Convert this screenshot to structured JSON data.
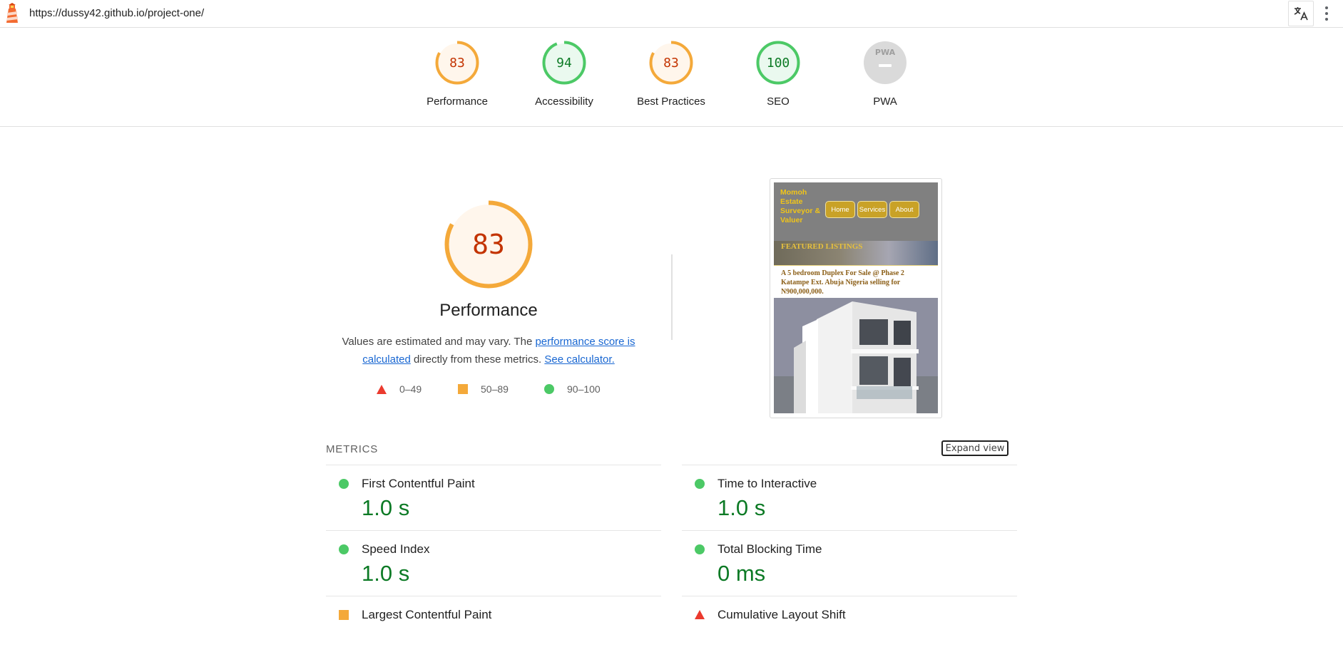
{
  "browser": {
    "url": "https://dussy42.github.io/project-one/",
    "logo_icon": "lighthouse-icon",
    "translate_icon": "translate-icon",
    "menu_icon": "more-vert-icon"
  },
  "colors": {
    "pass": "#0cce6b",
    "average": "#ffa400",
    "fail": "#ff4e42",
    "pass_text": "#0c7a25",
    "average_text": "#c33300",
    "link": "#1967d2"
  },
  "gauges": [
    {
      "label": "Performance",
      "score": "83",
      "level": "average",
      "fraction": 0.83
    },
    {
      "label": "Accessibility",
      "score": "94",
      "level": "pass",
      "fraction": 0.94
    },
    {
      "label": "Best Practices",
      "score": "83",
      "level": "average",
      "fraction": 0.83
    },
    {
      "label": "SEO",
      "score": "100",
      "level": "pass",
      "fraction": 1.0
    },
    {
      "label": "PWA",
      "score": "",
      "level": "na",
      "fraction": 0,
      "badge_text": "PWA",
      "icon": "pwa-badge-icon"
    }
  ],
  "performance": {
    "score": "83",
    "fraction": 0.83,
    "title": "Performance",
    "desc_prefix": "Values are estimated and may vary. The ",
    "link1": "performance score is calculated",
    "desc_middle": " directly from these metrics. ",
    "link2": "See calculator."
  },
  "legend": [
    {
      "range": "0–49",
      "icon": "fail-triangle-icon"
    },
    {
      "range": "50–89",
      "icon": "average-square-icon"
    },
    {
      "range": "90–100",
      "icon": "pass-circle-icon"
    }
  ],
  "screenshot": {
    "brand": "Momoh Estate Surveyor & Valuer",
    "nav": [
      "Home",
      "Services",
      "About"
    ],
    "featured": "FEATURED LISTINGS",
    "caption": "A 5 bedroom Duplex For Sale @ Phase 2 Katampe Ext. Abuja Nigeria selling for N900,000,000."
  },
  "metrics": {
    "heading": "METRICS",
    "expand_label": "Expand view",
    "items": [
      {
        "name": "First Contentful Paint",
        "value": "1.0 s",
        "level": "pass"
      },
      {
        "name": "Time to Interactive",
        "value": "1.0 s",
        "level": "pass"
      },
      {
        "name": "Speed Index",
        "value": "1.0 s",
        "level": "pass"
      },
      {
        "name": "Total Blocking Time",
        "value": "0 ms",
        "level": "pass"
      },
      {
        "name": "Largest Contentful Paint",
        "value": "",
        "level": "average"
      },
      {
        "name": "Cumulative Layout Shift",
        "value": "",
        "level": "fail"
      }
    ]
  }
}
